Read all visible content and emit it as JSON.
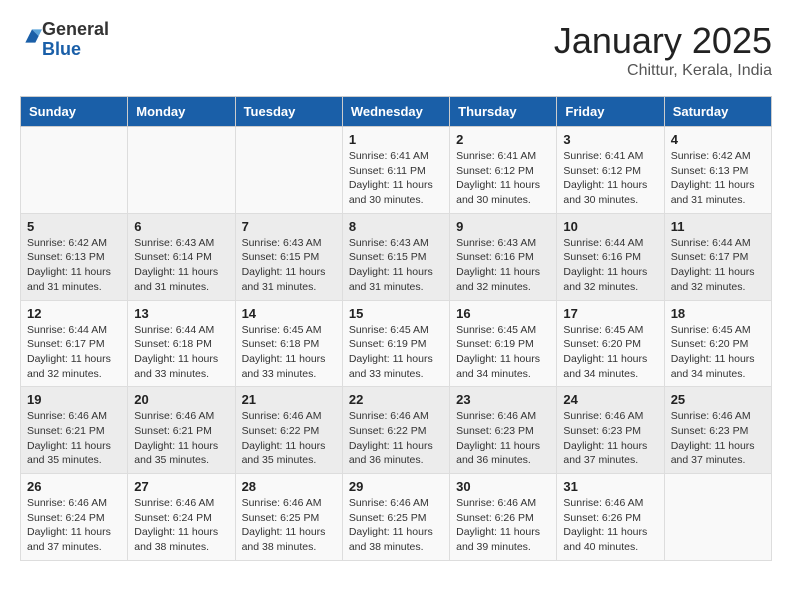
{
  "header": {
    "logo_general": "General",
    "logo_blue": "Blue",
    "title": "January 2025",
    "location": "Chittur, Kerala, India"
  },
  "weekdays": [
    "Sunday",
    "Monday",
    "Tuesday",
    "Wednesday",
    "Thursday",
    "Friday",
    "Saturday"
  ],
  "weeks": [
    [
      {
        "day": "",
        "info": ""
      },
      {
        "day": "",
        "info": ""
      },
      {
        "day": "",
        "info": ""
      },
      {
        "day": "1",
        "info": "Sunrise: 6:41 AM\nSunset: 6:11 PM\nDaylight: 11 hours and 30 minutes."
      },
      {
        "day": "2",
        "info": "Sunrise: 6:41 AM\nSunset: 6:12 PM\nDaylight: 11 hours and 30 minutes."
      },
      {
        "day": "3",
        "info": "Sunrise: 6:41 AM\nSunset: 6:12 PM\nDaylight: 11 hours and 30 minutes."
      },
      {
        "day": "4",
        "info": "Sunrise: 6:42 AM\nSunset: 6:13 PM\nDaylight: 11 hours and 31 minutes."
      }
    ],
    [
      {
        "day": "5",
        "info": "Sunrise: 6:42 AM\nSunset: 6:13 PM\nDaylight: 11 hours and 31 minutes."
      },
      {
        "day": "6",
        "info": "Sunrise: 6:43 AM\nSunset: 6:14 PM\nDaylight: 11 hours and 31 minutes."
      },
      {
        "day": "7",
        "info": "Sunrise: 6:43 AM\nSunset: 6:15 PM\nDaylight: 11 hours and 31 minutes."
      },
      {
        "day": "8",
        "info": "Sunrise: 6:43 AM\nSunset: 6:15 PM\nDaylight: 11 hours and 31 minutes."
      },
      {
        "day": "9",
        "info": "Sunrise: 6:43 AM\nSunset: 6:16 PM\nDaylight: 11 hours and 32 minutes."
      },
      {
        "day": "10",
        "info": "Sunrise: 6:44 AM\nSunset: 6:16 PM\nDaylight: 11 hours and 32 minutes."
      },
      {
        "day": "11",
        "info": "Sunrise: 6:44 AM\nSunset: 6:17 PM\nDaylight: 11 hours and 32 minutes."
      }
    ],
    [
      {
        "day": "12",
        "info": "Sunrise: 6:44 AM\nSunset: 6:17 PM\nDaylight: 11 hours and 32 minutes."
      },
      {
        "day": "13",
        "info": "Sunrise: 6:44 AM\nSunset: 6:18 PM\nDaylight: 11 hours and 33 minutes."
      },
      {
        "day": "14",
        "info": "Sunrise: 6:45 AM\nSunset: 6:18 PM\nDaylight: 11 hours and 33 minutes."
      },
      {
        "day": "15",
        "info": "Sunrise: 6:45 AM\nSunset: 6:19 PM\nDaylight: 11 hours and 33 minutes."
      },
      {
        "day": "16",
        "info": "Sunrise: 6:45 AM\nSunset: 6:19 PM\nDaylight: 11 hours and 34 minutes."
      },
      {
        "day": "17",
        "info": "Sunrise: 6:45 AM\nSunset: 6:20 PM\nDaylight: 11 hours and 34 minutes."
      },
      {
        "day": "18",
        "info": "Sunrise: 6:45 AM\nSunset: 6:20 PM\nDaylight: 11 hours and 34 minutes."
      }
    ],
    [
      {
        "day": "19",
        "info": "Sunrise: 6:46 AM\nSunset: 6:21 PM\nDaylight: 11 hours and 35 minutes."
      },
      {
        "day": "20",
        "info": "Sunrise: 6:46 AM\nSunset: 6:21 PM\nDaylight: 11 hours and 35 minutes."
      },
      {
        "day": "21",
        "info": "Sunrise: 6:46 AM\nSunset: 6:22 PM\nDaylight: 11 hours and 35 minutes."
      },
      {
        "day": "22",
        "info": "Sunrise: 6:46 AM\nSunset: 6:22 PM\nDaylight: 11 hours and 36 minutes."
      },
      {
        "day": "23",
        "info": "Sunrise: 6:46 AM\nSunset: 6:23 PM\nDaylight: 11 hours and 36 minutes."
      },
      {
        "day": "24",
        "info": "Sunrise: 6:46 AM\nSunset: 6:23 PM\nDaylight: 11 hours and 37 minutes."
      },
      {
        "day": "25",
        "info": "Sunrise: 6:46 AM\nSunset: 6:23 PM\nDaylight: 11 hours and 37 minutes."
      }
    ],
    [
      {
        "day": "26",
        "info": "Sunrise: 6:46 AM\nSunset: 6:24 PM\nDaylight: 11 hours and 37 minutes."
      },
      {
        "day": "27",
        "info": "Sunrise: 6:46 AM\nSunset: 6:24 PM\nDaylight: 11 hours and 38 minutes."
      },
      {
        "day": "28",
        "info": "Sunrise: 6:46 AM\nSunset: 6:25 PM\nDaylight: 11 hours and 38 minutes."
      },
      {
        "day": "29",
        "info": "Sunrise: 6:46 AM\nSunset: 6:25 PM\nDaylight: 11 hours and 38 minutes."
      },
      {
        "day": "30",
        "info": "Sunrise: 6:46 AM\nSunset: 6:26 PM\nDaylight: 11 hours and 39 minutes."
      },
      {
        "day": "31",
        "info": "Sunrise: 6:46 AM\nSunset: 6:26 PM\nDaylight: 11 hours and 40 minutes."
      },
      {
        "day": "",
        "info": ""
      }
    ]
  ]
}
